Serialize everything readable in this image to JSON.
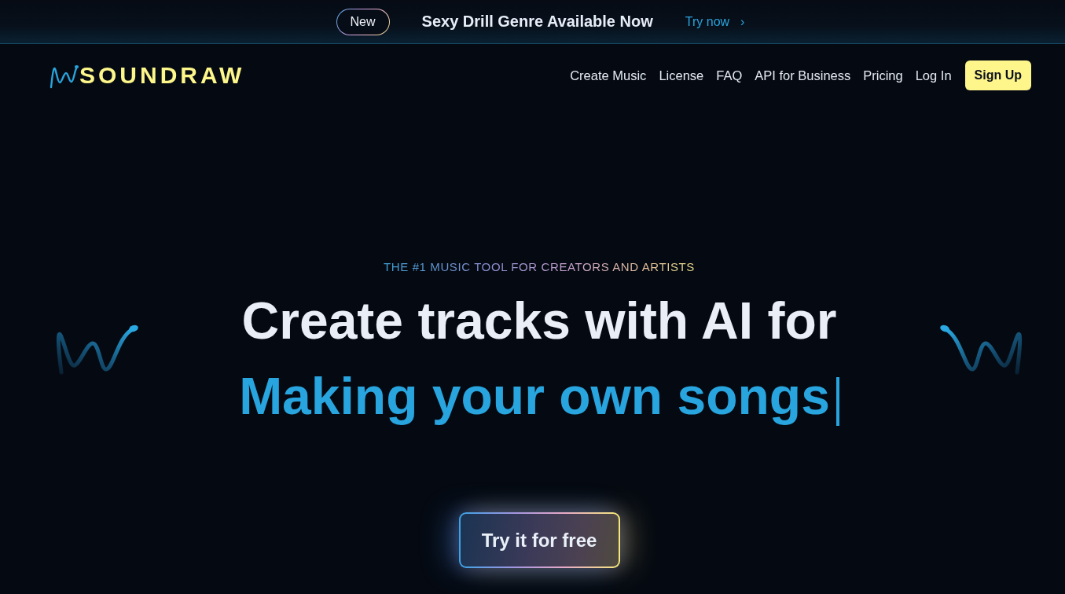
{
  "announcement_bar": {
    "badge": "New",
    "message": "Sexy Drill Genre Available Now",
    "link": {
      "label": "Try now",
      "arrow": "›"
    }
  },
  "header": {
    "logo": "SOUNDRAW",
    "nav_links": [
      "Create Music",
      "License",
      "FAQ",
      "API for Business",
      "Pricing",
      "Log In"
    ],
    "signup_button": "Sign Up"
  },
  "hero": {
    "eyebrow": "THE #1 MUSIC TOOL FOR CREATORS AND ARTISTS",
    "headline": "Create tracks with AI for",
    "typed_line": "Making your own songs",
    "cta_button": "Try it for free"
  }
}
